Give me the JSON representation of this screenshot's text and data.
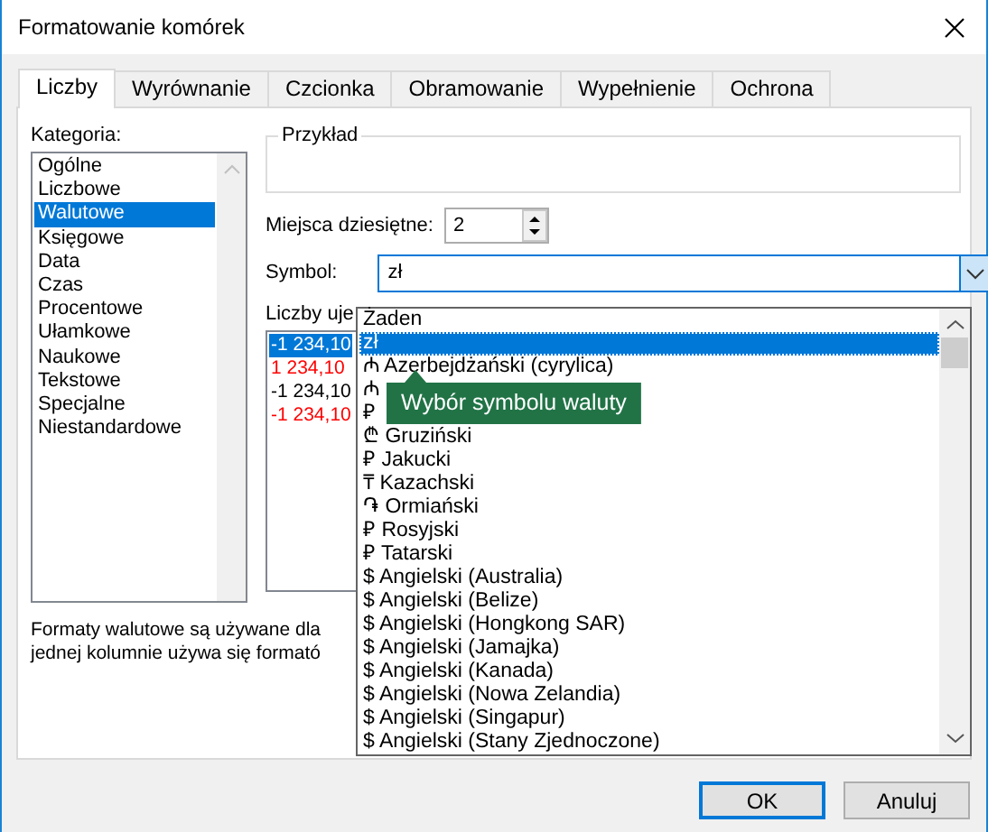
{
  "window": {
    "title": "Formatowanie komórek"
  },
  "tabs": [
    {
      "label": "Liczby",
      "selected": true
    },
    {
      "label": "Wyrównanie",
      "selected": false
    },
    {
      "label": "Czcionka",
      "selected": false
    },
    {
      "label": "Obramowanie",
      "selected": false
    },
    {
      "label": "Wypełnienie",
      "selected": false
    },
    {
      "label": "Ochrona",
      "selected": false
    }
  ],
  "category": {
    "label": "Kategoria:",
    "items": [
      {
        "label": "Ogólne",
        "selected": false
      },
      {
        "label": "Liczbowe",
        "selected": false
      },
      {
        "label": "Walutowe",
        "selected": true
      },
      {
        "label": "Księgowe",
        "selected": false
      },
      {
        "label": "Data",
        "selected": false
      },
      {
        "label": "Czas",
        "selected": false
      },
      {
        "label": "Procentowe",
        "selected": false
      },
      {
        "label": "Ułamkowe",
        "selected": false
      },
      {
        "label": "Naukowe",
        "selected": false
      },
      {
        "label": "Tekstowe",
        "selected": false
      },
      {
        "label": "Specjalne",
        "selected": false
      },
      {
        "label": "Niestandardowe",
        "selected": false
      }
    ]
  },
  "sample": {
    "label": "Przykład"
  },
  "decimal_places": {
    "label": "Miejsca dziesiętne:",
    "value": "2"
  },
  "symbol": {
    "label": "Symbol:",
    "value": "zł",
    "expanded": true,
    "options": [
      {
        "label": "Żaden",
        "selected": false
      },
      {
        "label": "zł",
        "selected": true
      },
      {
        "label": "₼ Azerbejdżański (cyrylica)",
        "selected": false
      },
      {
        "label": "₼",
        "selected": false
      },
      {
        "label": "₽",
        "selected": false
      },
      {
        "label": "₾ Gruziński",
        "selected": false
      },
      {
        "label": "₽ Jakucki",
        "selected": false
      },
      {
        "label": "₸ Kazachski",
        "selected": false
      },
      {
        "label": "֏ Ormiański",
        "selected": false
      },
      {
        "label": "₽ Rosyjski",
        "selected": false
      },
      {
        "label": "₽ Tatarski",
        "selected": false
      },
      {
        "label": "$ Angielski (Australia)",
        "selected": false
      },
      {
        "label": "$ Angielski (Belize)",
        "selected": false
      },
      {
        "label": "$ Angielski (Hongkong SAR)",
        "selected": false
      },
      {
        "label": "$ Angielski (Jamajka)",
        "selected": false
      },
      {
        "label": "$ Angielski (Kanada)",
        "selected": false
      },
      {
        "label": "$ Angielski (Nowa Zelandia)",
        "selected": false
      },
      {
        "label": "$ Angielski (Singapur)",
        "selected": false
      },
      {
        "label": "$ Angielski (Stany Zjednoczone)",
        "selected": false
      }
    ]
  },
  "negative_numbers": {
    "label": "Liczby uje",
    "items": [
      {
        "text": "-1 234,10",
        "selected": true
      },
      {
        "text": "1 234,10",
        "selected": false,
        "color": "#ff0000"
      },
      {
        "text": "-1 234,10",
        "selected": false,
        "color": "#000000"
      },
      {
        "text": "-1 234,10",
        "selected": false,
        "color": "#ff0000"
      }
    ]
  },
  "description": [
    "Formaty walutowe są używane dla",
    "jednej kolumnie używa się formató"
  ],
  "tooltip": "Wybór symbolu waluty",
  "buttons": [
    {
      "label": "OK",
      "default": true
    },
    {
      "label": "Anuluj",
      "default": false
    }
  ]
}
